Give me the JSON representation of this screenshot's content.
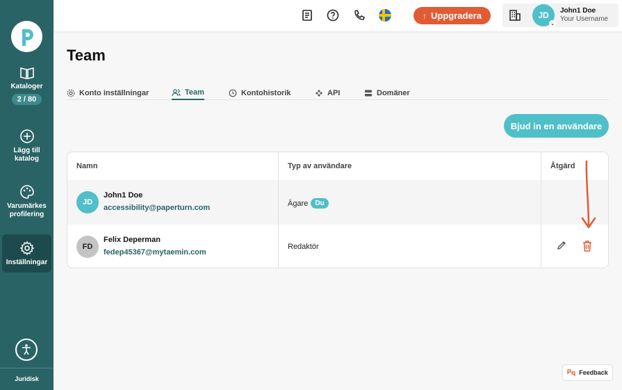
{
  "sidebar": {
    "items": [
      {
        "label": "Kataloger",
        "badge": "2 / 80"
      },
      {
        "label": "Lägg till katalog"
      },
      {
        "label": "Varumärkes profilering"
      },
      {
        "label": "Inställningar"
      }
    ],
    "footer": "Juridisk"
  },
  "topbar": {
    "upgrade_label": "Uppgradera",
    "user_initials": "JD",
    "user_name": "John1 Doe",
    "user_sub": "Your Username"
  },
  "page": {
    "title": "Team",
    "tabs": [
      "Konto inställningar",
      "Team",
      "Kontohistorik",
      "API",
      "Domäner"
    ],
    "invite_label": "Bjud in en användare"
  },
  "table": {
    "headers": [
      "Namn",
      "Typ av användare",
      "Åtgärd"
    ],
    "rows": [
      {
        "initials": "JD",
        "name": "John1 Doe",
        "email": "accessibility@paperturn.com",
        "type": "Ägare",
        "badge": "Du"
      },
      {
        "initials": "FD",
        "name": "Felix Deperman",
        "email": "fedep45367@mytaemin.com",
        "type": "Redaktör"
      }
    ]
  },
  "feedback_label": "Feedback",
  "colors": {
    "sidebar": "#2a6366",
    "accent": "#4fbfc9",
    "upgrade": "#e15b34",
    "annotation_arrow": "#e15b34"
  },
  "icons": [
    "paperturn-logo",
    "catalog-icon",
    "plus-circle-icon",
    "palette-icon",
    "gear-icon",
    "accessibility-icon",
    "document-icon",
    "help-icon",
    "phone-icon",
    "swedish-flag-icon",
    "arrow-up-icon",
    "building-icon",
    "team-icon",
    "history-icon",
    "api-icon",
    "server-icon",
    "edit-icon",
    "trash-icon",
    "feedback-icon"
  ]
}
